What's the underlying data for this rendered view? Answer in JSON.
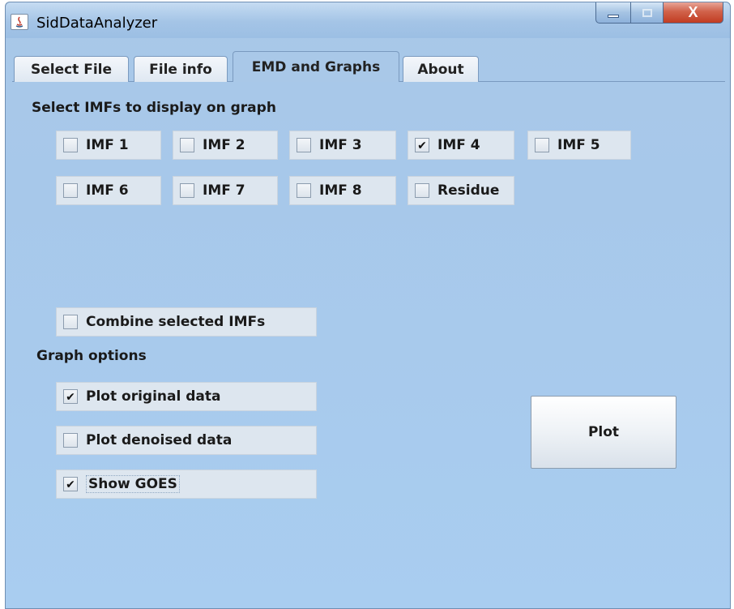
{
  "window": {
    "title": "SidDataAnalyzer",
    "controls": {
      "minimize": "▁",
      "maximize": "□",
      "close": "X"
    }
  },
  "tabs": [
    {
      "label": "Select File",
      "active": false
    },
    {
      "label": "File info",
      "active": false
    },
    {
      "label": "EMD and Graphs",
      "active": true
    },
    {
      "label": "About",
      "active": false
    }
  ],
  "imf_section": {
    "heading": "Select IMFs to display on graph",
    "checkboxes": [
      {
        "label": "IMF 1",
        "checked": false
      },
      {
        "label": "IMF 2",
        "checked": false
      },
      {
        "label": "IMF 3",
        "checked": false
      },
      {
        "label": "IMF 4",
        "checked": true
      },
      {
        "label": "IMF 5",
        "checked": false
      },
      {
        "label": "IMF 6",
        "checked": false
      },
      {
        "label": "IMF 7",
        "checked": false
      },
      {
        "label": "IMF 8",
        "checked": false
      },
      {
        "label": "Residue",
        "checked": false
      }
    ],
    "combine": {
      "label": "Combine selected IMFs",
      "checked": false
    }
  },
  "graph_options": {
    "heading": "Graph options",
    "plot_original": {
      "label": "Plot original data",
      "checked": true
    },
    "plot_denoised": {
      "label": "Plot denoised data",
      "checked": false
    },
    "show_goes": {
      "label": "Show GOES",
      "checked": true
    }
  },
  "plot_button": {
    "label": "Plot"
  },
  "check_glyph": "✔"
}
